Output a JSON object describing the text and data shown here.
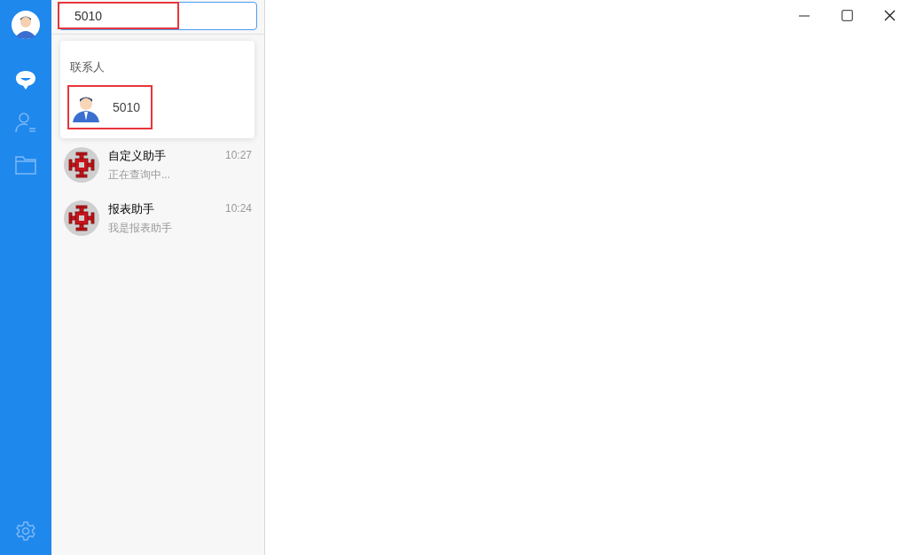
{
  "sidebar": {
    "items": [
      {
        "kind": "chat",
        "selected": true
      },
      {
        "kind": "contacts",
        "selected": false
      },
      {
        "kind": "files",
        "selected": false
      }
    ]
  },
  "search": {
    "value": "5010"
  },
  "dropdown": {
    "heading": "联系人",
    "results": [
      {
        "name": "5010"
      }
    ]
  },
  "conversations": [
    {
      "name": "自定义助手",
      "time": "10:27",
      "preview": "正在查询中..."
    },
    {
      "name": "报表助手",
      "time": "10:24",
      "preview": "我是报表助手"
    }
  ]
}
